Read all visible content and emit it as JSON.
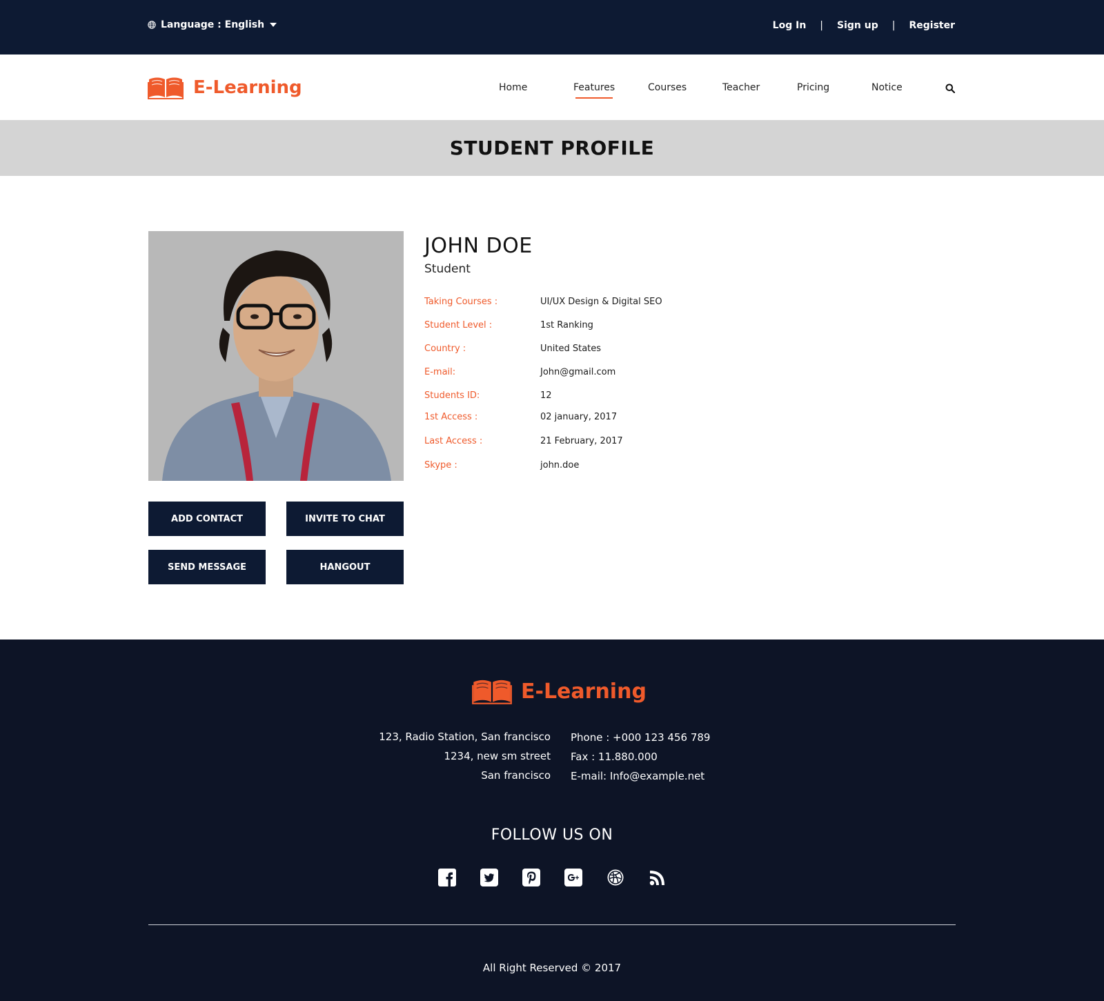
{
  "topbar": {
    "language_label": "Language : English",
    "login": "Log In",
    "signup": "Sign up",
    "register": "Register",
    "separator": "|"
  },
  "brand": {
    "name": "E-Learning",
    "accent_color": "#ef5a2b",
    "dark_color": "#0d1a33"
  },
  "nav": {
    "items": [
      "Home",
      "Features",
      "Courses",
      "Teacher",
      "Pricing",
      "Notice"
    ],
    "active": "Features",
    "search_icon": "search-icon"
  },
  "page_title": "STUDENT PROFILE",
  "profile": {
    "name": "JOHN DOE",
    "role": "Student",
    "fields": [
      {
        "label": "Taking Courses :",
        "value": "UI/UX Design & Digital SEO"
      },
      {
        "label": "Student Level :",
        "value": "1st Ranking"
      },
      {
        "label": "Country :",
        "value": "United States"
      },
      {
        "label": "E-mail:",
        "value": "John@gmail.com"
      },
      {
        "label": "Students ID:",
        "value": "12"
      },
      {
        "label": "1st Access :",
        "value": "02 january, 2017"
      },
      {
        "label": "Last Access :",
        "value": "21 February, 2017"
      },
      {
        "label": "Skype :",
        "value": "john.doe"
      }
    ]
  },
  "actions": {
    "add_contact": "ADD CONTACT",
    "invite_to_chat": "INVITE TO CHAT",
    "send_message": "SEND MESSAGE",
    "hangout": "HANGOUT"
  },
  "footer": {
    "address": [
      "123, Radio Station, San francisco",
      "1234, new sm street",
      "San francisco"
    ],
    "contact": [
      "Phone : +000 123 456 789",
      "Fax : 11.880.000",
      "E-mail: Info@example.net"
    ],
    "follow_title": "FOLLOW US ON",
    "social_icons": [
      "facebook-icon",
      "twitter-icon",
      "pinterest-icon",
      "google-plus-icon",
      "dribbble-icon",
      "rss-icon"
    ],
    "copyright": "All Right Reserved © 2017"
  }
}
